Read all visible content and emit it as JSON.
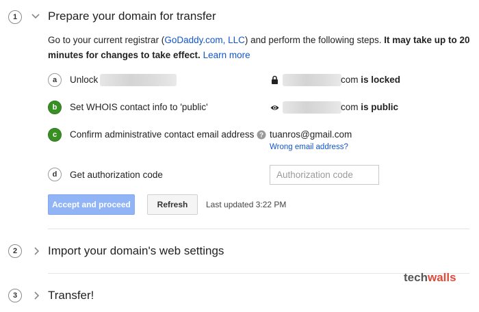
{
  "section1": {
    "number": "1",
    "title": "Prepare your domain for transfer",
    "desc_prefix": "Go to your current registrar (",
    "registrar_link": "GoDaddy.com, LLC",
    "desc_mid": ") and perform the following steps. ",
    "desc_bold": "It may take up to 20 minutes for changes to take effect.",
    "learn_more": "Learn more"
  },
  "steps": [
    {
      "badge": "a",
      "label": "Unlock",
      "status_suffix": "com",
      "status_bold": "is locked",
      "status_icon": "lock-icon"
    },
    {
      "badge": "b",
      "label": "Set WHOIS contact info to 'public'",
      "status_suffix": "com",
      "status_bold": "is public",
      "status_icon": "eye-icon"
    },
    {
      "badge": "c",
      "label": "Confirm administrative contact email address",
      "email": "tuanros@gmail.com",
      "wrong_email_link": "Wrong email address?",
      "help_icon": "help-icon"
    },
    {
      "badge": "d",
      "label": "Get authorization code",
      "auth_placeholder": "Authorization code"
    }
  ],
  "buttons": {
    "accept": "Accept and proceed",
    "refresh": "Refresh"
  },
  "last_updated": "Last updated 3:22 PM",
  "section2": {
    "number": "2",
    "title": "Import your domain's web settings"
  },
  "section3": {
    "number": "3",
    "title": "Transfer!"
  },
  "watermark": {
    "part1": "tech",
    "part2": "walls"
  },
  "colors": {
    "link": "#1155cc",
    "done_badge": "#3a8f24",
    "primary_button_disabled": "#90b4f5",
    "watermark_tech": "#555555",
    "watermark_walls": "#e04a3a"
  }
}
